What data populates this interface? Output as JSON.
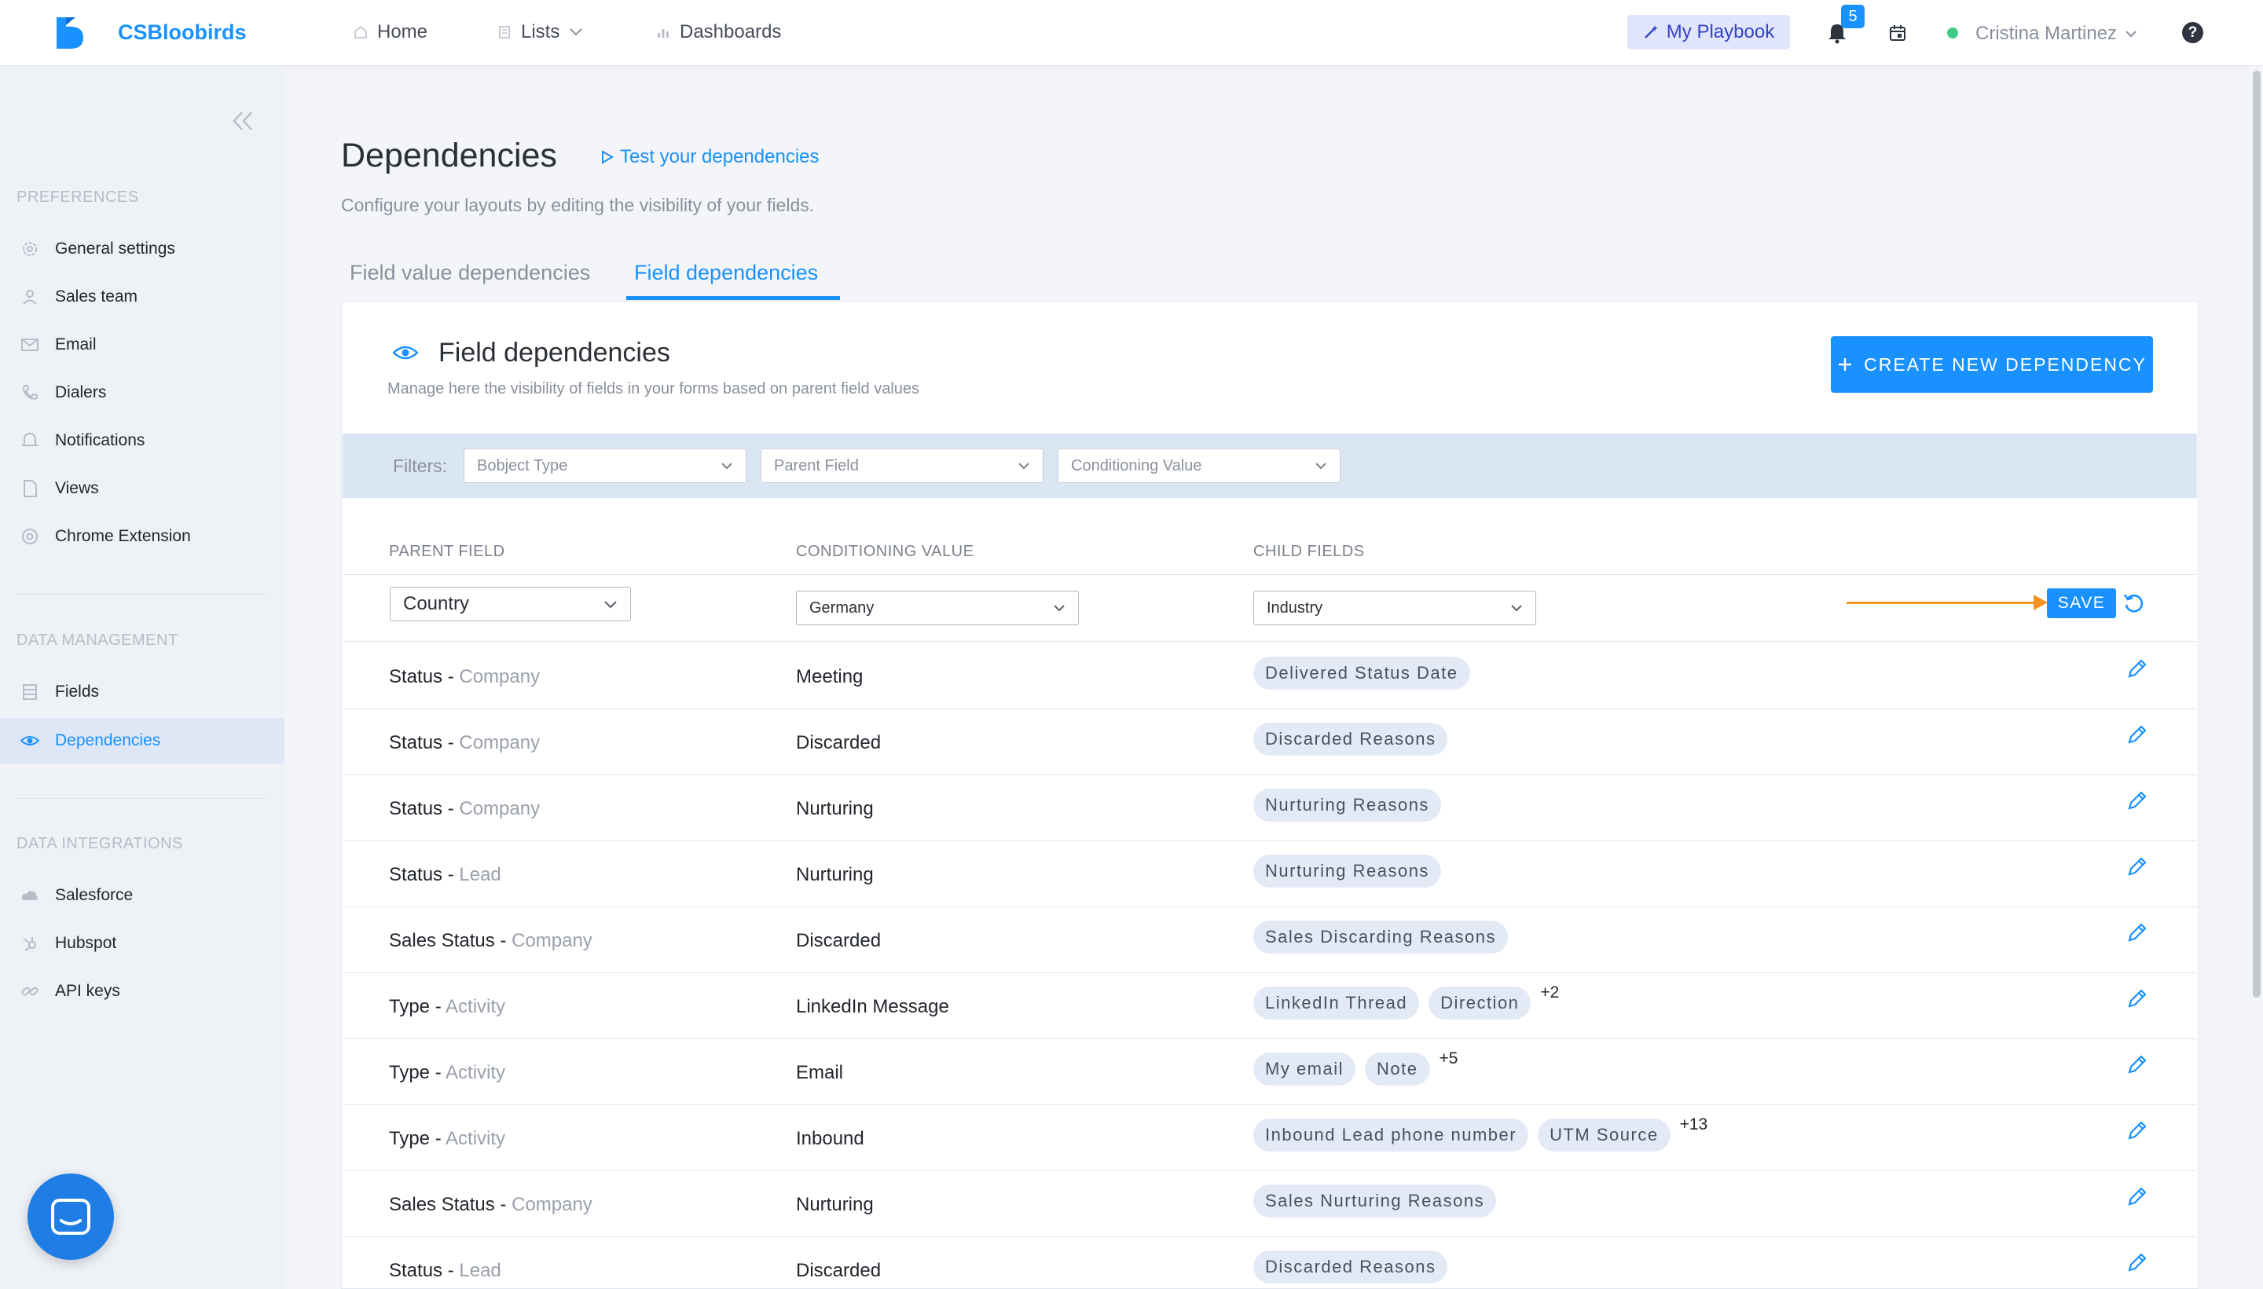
{
  "topbar": {
    "brand": "CSBloobirds",
    "nav": [
      {
        "label": "Home",
        "icon": "home-icon"
      },
      {
        "label": "Lists",
        "icon": "list-icon"
      },
      {
        "label": "Dashboards",
        "icon": "chart-icon"
      }
    ],
    "playbook_label": "My Playbook",
    "notifications_count": "5",
    "user_name": "Cristina Martinez",
    "help_label": "?"
  },
  "sidebar": {
    "sections": [
      {
        "title": "PREFERENCES",
        "items": [
          {
            "label": "General settings",
            "icon": "gear-icon"
          },
          {
            "label": "Sales team",
            "icon": "user-icon"
          },
          {
            "label": "Email",
            "icon": "mail-icon"
          },
          {
            "label": "Dialers",
            "icon": "phone-icon"
          },
          {
            "label": "Notifications",
            "icon": "bell-icon"
          },
          {
            "label": "Views",
            "icon": "file-icon"
          },
          {
            "label": "Chrome Extension",
            "icon": "chrome-icon"
          }
        ]
      },
      {
        "title": "DATA MANAGEMENT",
        "items": [
          {
            "label": "Fields",
            "icon": "fields-icon"
          },
          {
            "label": "Dependencies",
            "icon": "eye-icon",
            "active": true
          }
        ]
      },
      {
        "title": "DATA INTEGRATIONS",
        "items": [
          {
            "label": "Salesforce",
            "icon": "cloud-icon"
          },
          {
            "label": "Hubspot",
            "icon": "hubspot-icon"
          },
          {
            "label": "API keys",
            "icon": "link-icon"
          }
        ]
      }
    ]
  },
  "page": {
    "title": "Dependencies",
    "test_link": "Test your dependencies",
    "subtitle": "Configure your layouts by editing the visibility of your fields.",
    "tabs": [
      {
        "label": "Field value dependencies",
        "active": false
      },
      {
        "label": "Field dependencies",
        "active": true
      }
    ]
  },
  "card": {
    "title": "Field dependencies",
    "subtitle": "Manage here the visibility of fields in your forms based on parent field values",
    "create_button": "CREATE NEW DEPENDENCY",
    "filters_label": "Filters:",
    "filters": [
      "Bobject Type",
      "Parent Field",
      "Conditioning Value"
    ],
    "columns": [
      "PARENT FIELD",
      "CONDITIONING VALUE",
      "CHILD FIELDS"
    ]
  },
  "edit_row": {
    "parent": "Country",
    "value": "Germany",
    "child": "Industry",
    "save_label": "SAVE"
  },
  "rows": [
    {
      "field": "Status",
      "object": "Company",
      "value": "Meeting",
      "children": [
        "Delivered Status Date"
      ],
      "more": ""
    },
    {
      "field": "Status",
      "object": "Company",
      "value": "Discarded",
      "children": [
        "Discarded Reasons"
      ],
      "more": ""
    },
    {
      "field": "Status",
      "object": "Company",
      "value": "Nurturing",
      "children": [
        "Nurturing Reasons"
      ],
      "more": ""
    },
    {
      "field": "Status",
      "object": "Lead",
      "value": "Nurturing",
      "children": [
        "Nurturing Reasons"
      ],
      "more": ""
    },
    {
      "field": "Sales Status",
      "object": "Company",
      "value": "Discarded",
      "children": [
        "Sales Discarding Reasons"
      ],
      "more": ""
    },
    {
      "field": "Type",
      "object": "Activity",
      "value": "LinkedIn Message",
      "children": [
        "LinkedIn Thread",
        "Direction"
      ],
      "more": "+2"
    },
    {
      "field": "Type",
      "object": "Activity",
      "value": "Email",
      "children": [
        "My email",
        "Note"
      ],
      "more": "+5"
    },
    {
      "field": "Type",
      "object": "Activity",
      "value": "Inbound",
      "children": [
        "Inbound Lead phone number",
        "UTM Source"
      ],
      "more": "+13"
    },
    {
      "field": "Sales Status",
      "object": "Company",
      "value": "Nurturing",
      "children": [
        "Sales Nurturing Reasons"
      ],
      "more": ""
    },
    {
      "field": "Status",
      "object": "Lead",
      "value": "Discarded",
      "children": [
        "Discarded Reasons"
      ],
      "more": ""
    }
  ],
  "colors": {
    "accent": "#1991ff",
    "arrow": "#f39321",
    "playbook_bg": "#e1e5fb",
    "online": "#3ecb84"
  }
}
